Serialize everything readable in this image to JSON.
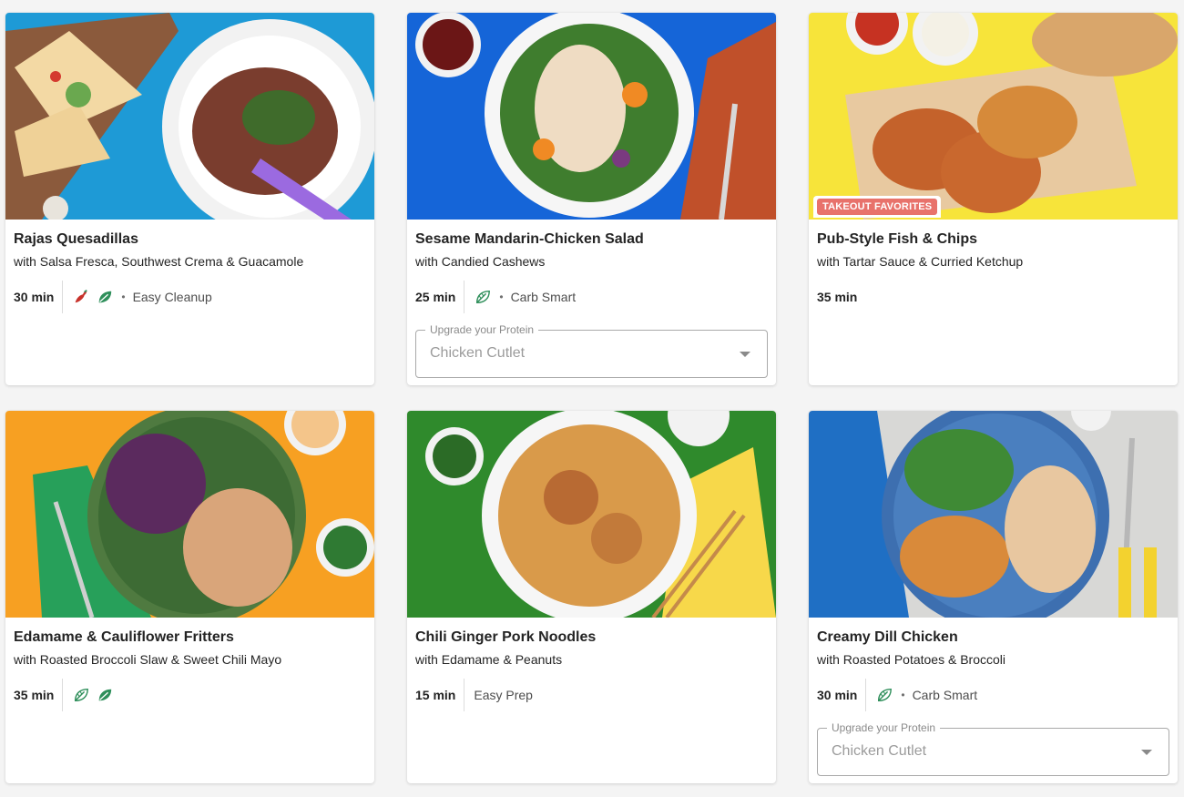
{
  "cards": [
    {
      "title": "Rajas Quesadillas",
      "subtitle": "with Salsa Fresca, Southwest Crema & Guacamole",
      "time": "30 min",
      "icons": [
        "chili-pepper-icon",
        "leaf-icon"
      ],
      "tag": "Easy Cleanup"
    },
    {
      "title": "Sesame Mandarin-Chicken Salad",
      "subtitle": "with Candied Cashews",
      "time": "25 min",
      "icons": [
        "carb-smart-leaf-icon"
      ],
      "tag": "Carb Smart",
      "upgrade": {
        "label": "Upgrade your Protein",
        "value": "Chicken Cutlet"
      }
    },
    {
      "badge": "TAKEOUT FAVORITES",
      "title": "Pub-Style Fish & Chips",
      "subtitle": "with Tartar Sauce & Curried Ketchup",
      "time": "35 min"
    },
    {
      "title": "Edamame & Cauliflower Fritters",
      "subtitle": "with Roasted Broccoli Slaw & Sweet Chili Mayo",
      "time": "35 min",
      "icons": [
        "carb-smart-leaf-icon",
        "leaf-icon"
      ]
    },
    {
      "title": "Chili Ginger Pork Noodles",
      "subtitle": "with Edamame & Peanuts",
      "time": "15 min",
      "tag": "Easy Prep"
    },
    {
      "title": "Creamy Dill Chicken",
      "subtitle": "with Roasted Potatoes & Broccoli",
      "time": "30 min",
      "icons": [
        "carb-smart-leaf-icon"
      ],
      "tag": "Carb Smart",
      "upgrade": {
        "label": "Upgrade your Protein",
        "value": "Chicken Cutlet"
      }
    }
  ],
  "colors": {
    "badge": "#e8726b",
    "icon_green": "#2f8f5b",
    "chili_red": "#c8322b",
    "card_bg": "#ffffff",
    "page_bg": "#f4f4f4"
  }
}
